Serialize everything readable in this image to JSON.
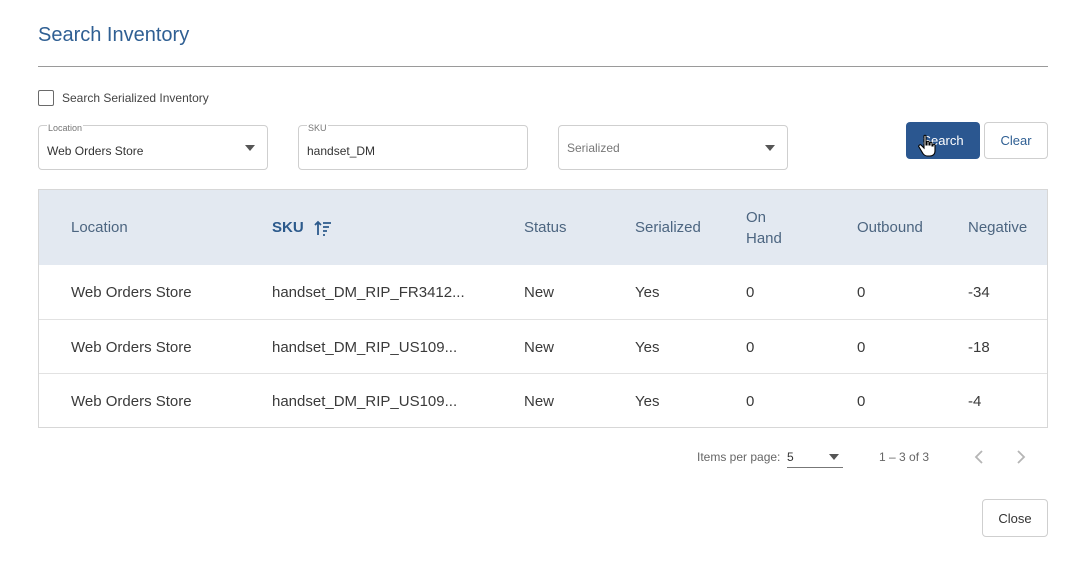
{
  "dialog": {
    "title": "Search Inventory"
  },
  "filters": {
    "serialized_checkbox_label": "Search Serialized Inventory",
    "location": {
      "label": "Location",
      "value": "Web Orders Store"
    },
    "sku": {
      "label": "SKU",
      "value": "handset_DM"
    },
    "serialized": {
      "placeholder": "Serialized"
    },
    "search_label": "Search",
    "clear_label": "Clear"
  },
  "table": {
    "headers": {
      "location": "Location",
      "sku": "SKU",
      "status": "Status",
      "serialized": "Serialized",
      "on_hand_1": "On",
      "on_hand_2": "Hand",
      "outbound": "Outbound",
      "negative": "Negative"
    },
    "rows": [
      {
        "location": "Web Orders Store",
        "sku": "handset_DM_RIP_FR3412...",
        "status": "New",
        "serialized": "Yes",
        "on_hand": "0",
        "outbound": "0",
        "negative": "-34"
      },
      {
        "location": "Web Orders Store",
        "sku": "handset_DM_RIP_US109...",
        "status": "New",
        "serialized": "Yes",
        "on_hand": "0",
        "outbound": "0",
        "negative": "-18"
      },
      {
        "location": "Web Orders Store",
        "sku": "handset_DM_RIP_US109...",
        "status": "New",
        "serialized": "Yes",
        "on_hand": "0",
        "outbound": "0",
        "negative": "-4"
      }
    ]
  },
  "pagination": {
    "items_per_page_label": "Items per page:",
    "items_per_page": "5",
    "range": "1 – 3 of 3"
  },
  "footer": {
    "close_label": "Close"
  },
  "colors": {
    "accent": "#2b5790",
    "header_bg": "#e3e9f1"
  }
}
